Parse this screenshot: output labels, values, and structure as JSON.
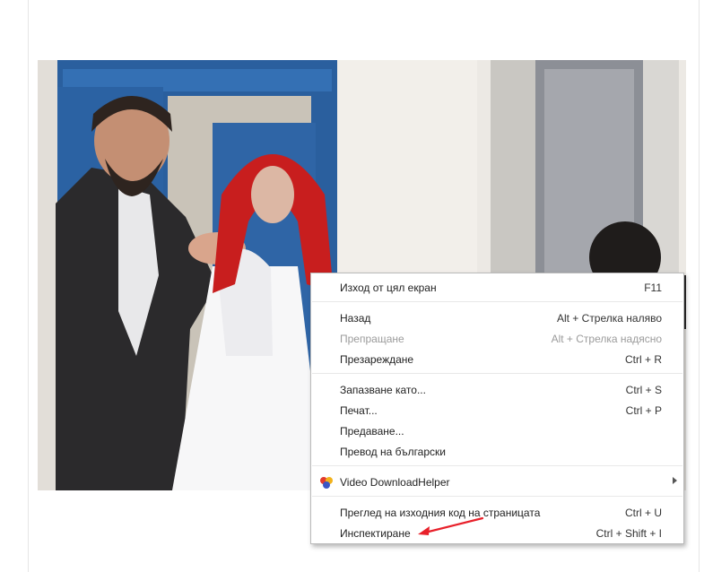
{
  "menu": {
    "items": [
      {
        "label": "Изход от цял екран",
        "shortcut": "F11",
        "disabled": false
      },
      {
        "label": "Назад",
        "shortcut": "Alt + Стрелка наляво",
        "disabled": false
      },
      {
        "label": "Препращане",
        "shortcut": "Alt + Стрелка надясно",
        "disabled": true
      },
      {
        "label": "Презареждане",
        "shortcut": "Ctrl + R",
        "disabled": false
      },
      {
        "label": "Запазване като...",
        "shortcut": "Ctrl + S",
        "disabled": false
      },
      {
        "label": "Печат...",
        "shortcut": "Ctrl + P",
        "disabled": false
      },
      {
        "label": "Предаване...",
        "shortcut": "",
        "disabled": false
      },
      {
        "label": "Превод на български",
        "shortcut": "",
        "disabled": false
      },
      {
        "label": "Video DownloadHelper",
        "shortcut": "",
        "disabled": false,
        "icon": "video-downloadhelper-icon",
        "has_submenu": true
      },
      {
        "label": "Преглед на изходния код на страницата",
        "shortcut": "Ctrl + U",
        "disabled": false
      },
      {
        "label": "Инспектиране",
        "shortcut": "Ctrl + Shift + I",
        "disabled": false
      }
    ]
  },
  "colors": {
    "annotation_arrow": "#e8202a",
    "door_blue": "#2a5f9e",
    "veil_red": "#c81e1e"
  }
}
